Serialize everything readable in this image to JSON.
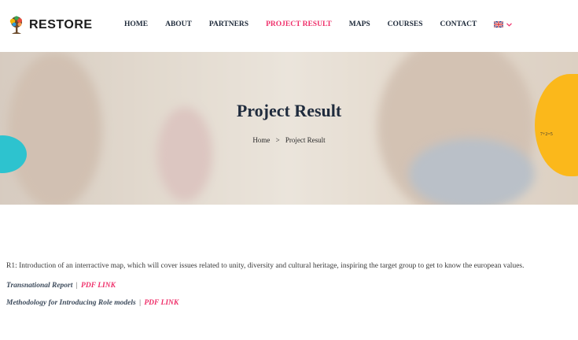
{
  "logo": {
    "text": "RESTORE",
    "icon": "tree-logo-icon"
  },
  "nav": {
    "items": [
      {
        "label": "HOME"
      },
      {
        "label": "ABOUT"
      },
      {
        "label": "PARTNERS"
      },
      {
        "label": "PROJECT RESULT",
        "active": true
      },
      {
        "label": "MAPS"
      },
      {
        "label": "COURSES"
      },
      {
        "label": "CONTACT"
      }
    ],
    "language_icon": "uk-flag-icon"
  },
  "hero": {
    "title": "Project Result",
    "breadcrumb": {
      "home": "Home",
      "separator": ">",
      "current": "Project Result"
    },
    "decoration_text": "7+2=5"
  },
  "content": {
    "r1_text": "R1:  Introduction of an interractive map, which will cover issues related to unity, diversity and cultural heritage, inspiring the target group to get to know the european values.",
    "rows": [
      {
        "label": "Transnational Report",
        "separator": "|",
        "link": "PDF LINK"
      },
      {
        "label": "Methodology for Introducing Role models",
        "separator": "|",
        "link": "PDF LINK"
      }
    ]
  },
  "colors": {
    "accent": "#ef2f6a",
    "navy": "#1e2a3a",
    "yellow": "#fbb81b",
    "teal": "#2dc3cf"
  }
}
